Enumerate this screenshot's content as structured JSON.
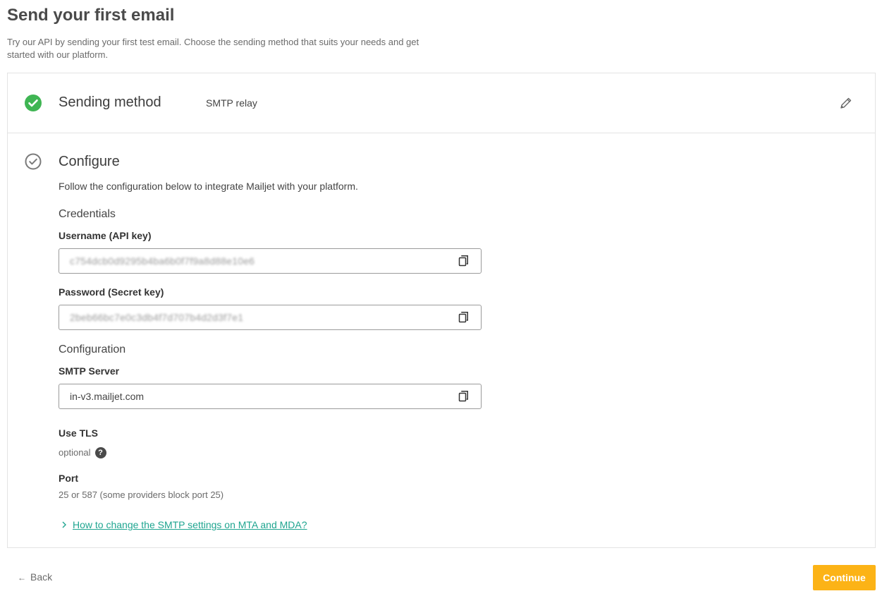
{
  "page": {
    "title": "Send your first email",
    "subtitle": "Try our API by sending your first test email. Choose the sending method that suits your needs and get started with our platform."
  },
  "steps": {
    "sending_method": {
      "title": "Sending method",
      "value": "SMTP relay",
      "status": "completed",
      "icons": {
        "status": "check-circle-icon",
        "edit": "pencil-icon"
      }
    },
    "configure": {
      "title": "Configure",
      "description": "Follow the configuration below to integrate Mailjet with your platform.",
      "status": "current",
      "credentials": {
        "title": "Credentials",
        "username_label": "Username (API key)",
        "username_value": "c754dcb0d9295b4ba6b0f7f9a8d88e10e6",
        "password_label": "Password (Secret key)",
        "password_value": "2beb66bc7e0c3db4f7d707b4d2d3f7e1"
      },
      "configuration": {
        "title": "Configuration",
        "smtp_label": "SMTP Server",
        "smtp_value": "in-v3.mailjet.com",
        "tls_label": "Use TLS",
        "tls_value": "optional",
        "port_label": "Port",
        "port_value": "25 or 587 (some providers block port 25)"
      },
      "help_link": "How to change the SMTP settings on MTA and MDA?"
    }
  },
  "footer": {
    "back_label": "Back",
    "continue_label": "Continue"
  },
  "colors": {
    "success": "#3fb553",
    "link": "#1fa590",
    "primary_button": "#fcb316"
  }
}
